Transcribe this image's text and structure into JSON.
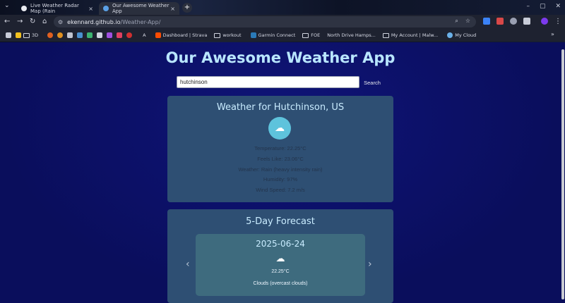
{
  "browser": {
    "tabs": [
      {
        "title": "Live Weather Radar Map (Rain",
        "color": "#e8eaf0"
      },
      {
        "title": "Our Awesome Weather App",
        "color": "#5aa0e6"
      }
    ],
    "url_host": "ekennard.github.io",
    "url_path": "/Weather-App/",
    "bookmarks": [
      {
        "label": "3D",
        "color": "#e0a030",
        "folder": true
      },
      {
        "label": "A",
        "color": "#5b7fd6"
      },
      {
        "label": "Dashboard | Strava",
        "color": "#fc4c02"
      },
      {
        "label": "workout",
        "folder": true
      },
      {
        "label": "Garmin Connect",
        "color": "#2a7ab8"
      },
      {
        "label": "FOE",
        "folder": true
      },
      {
        "label": "North Drive Hamps...",
        "color": "#ffffff"
      },
      {
        "label": "My Account | Malw...",
        "folder": true
      },
      {
        "label": "My Cloud",
        "color": "#6ab0e8"
      }
    ],
    "close_glyph": "×",
    "new_tab_glyph": "+"
  },
  "app": {
    "title": "Our Awesome Weather App",
    "search": {
      "value": "hutchinson",
      "button": "Search"
    },
    "current": {
      "heading": "Weather for Hutchinson, US",
      "icon": "cloud-rain-icon",
      "temperature": "Temperature: 22.25°C",
      "feels_like": "Feels Like: 23.06°C",
      "weather": "Weather: Rain (heavy intensity rain)",
      "humidity": "Humidity: 97%",
      "wind": "Wind Speed: 7.2 m/s"
    },
    "forecast": {
      "heading": "5-Day Forecast",
      "day": {
        "date": "2025-06-24",
        "icon": "cloud-icon",
        "temp": "22.25°C",
        "desc": "Clouds (overcast clouds)"
      }
    }
  }
}
